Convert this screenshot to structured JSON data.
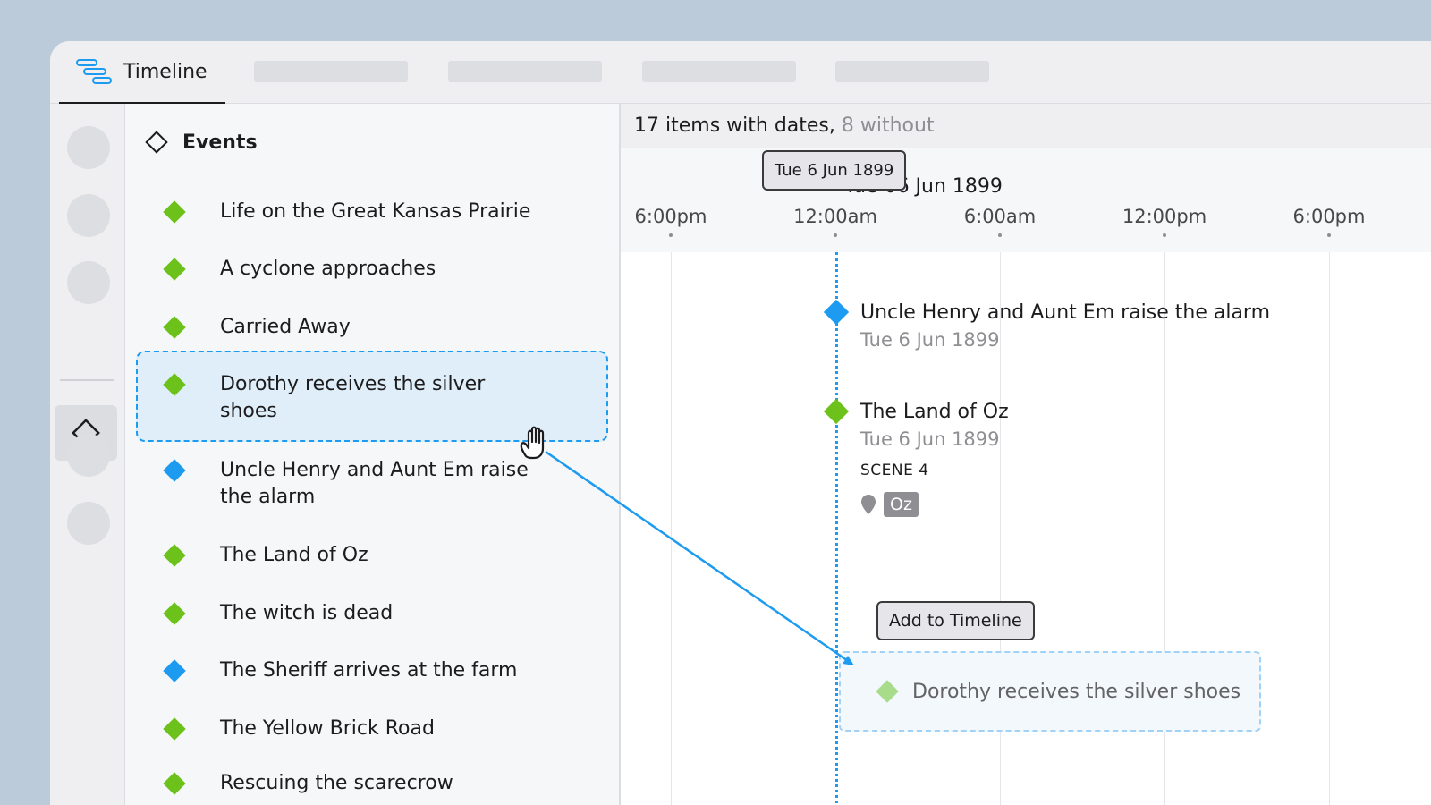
{
  "tabbar": {
    "active_tab": "Timeline",
    "placeholder_tabs": 4
  },
  "events_panel": {
    "title": "Events",
    "items": [
      {
        "label": "Life on the Great Kansas Prairie",
        "color": "#6cc21b"
      },
      {
        "label": "A cyclone approaches",
        "color": "#6cc21b"
      },
      {
        "label": "Carried Away",
        "color": "#6cc21b"
      },
      {
        "label": "Dorothy receives the silver shoes",
        "color": "#6cc21b",
        "selected": true
      },
      {
        "label": "Uncle Henry and Aunt Em raise the alarm",
        "color": "#1d9bf0"
      },
      {
        "label": "The Land of Oz",
        "color": "#6cc21b"
      },
      {
        "label": "The witch is dead",
        "color": "#6cc21b"
      },
      {
        "label": "The Sheriff arrives at the farm",
        "color": "#1d9bf0"
      },
      {
        "label": "The Yellow Brick Road",
        "color": "#6cc21b"
      },
      {
        "label": "Rescuing the scarecrow",
        "color": "#6cc21b"
      }
    ]
  },
  "timeline": {
    "summary_count": "17 items with dates,",
    "summary_without": "8 without",
    "date_tooltip": "Tue 6 Jun 1899",
    "day_label": "Tue 06 Jun 1899",
    "ticks": [
      "6:00pm",
      "12:00am",
      "6:00am",
      "12:00pm",
      "6:00pm"
    ],
    "cards": [
      {
        "title": "Uncle Henry and Aunt Em raise the alarm",
        "date": "Tue 6 Jun 1899",
        "color": "#1d9bf0"
      },
      {
        "title": "The Land of Oz",
        "date": "Tue 6 Jun 1899",
        "scene": "SCENE 4",
        "tag": "Oz",
        "color": "#6cc21b"
      }
    ],
    "add_button": "Add to Timeline",
    "drop_preview": "Dorothy receives the silver shoes"
  },
  "colors": {
    "accent": "#1d9bf0",
    "event_green": "#6cc21b",
    "event_blue": "#1d9bf0"
  }
}
